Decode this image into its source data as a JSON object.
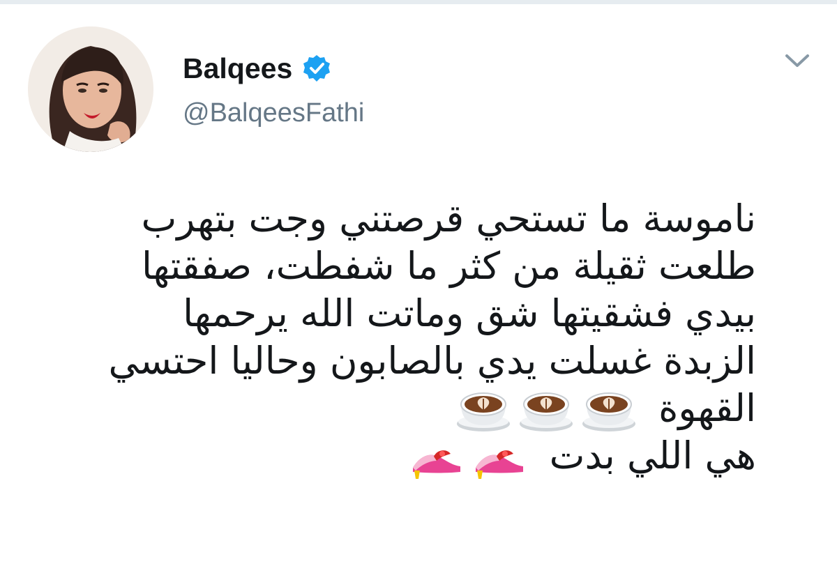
{
  "user": {
    "display_name": "Balqees",
    "handle": "@BalqeesFathi",
    "verified": true
  },
  "icons": {
    "verified": "verified-badge-icon",
    "menu": "chevron-down-icon",
    "coffee": "coffee-emoji",
    "shoe": "high-heel-shoe-emoji"
  },
  "colors": {
    "verified_blue": "#1da1f2",
    "handle_gray": "#657786",
    "text": "#14171a"
  },
  "tweet": {
    "lines": [
      "ناموسة ما تستحي قرصتني وجت بتهرب",
      "طلعت ثقيلة من كثر ما شفطت، صفقتها",
      "بيدي فشقيتها شق وماتت الله يرحمها",
      "الزبدة غسلت يدي بالصابون وحاليا احتسي",
      "القهوة",
      "هي اللي بدت"
    ]
  }
}
